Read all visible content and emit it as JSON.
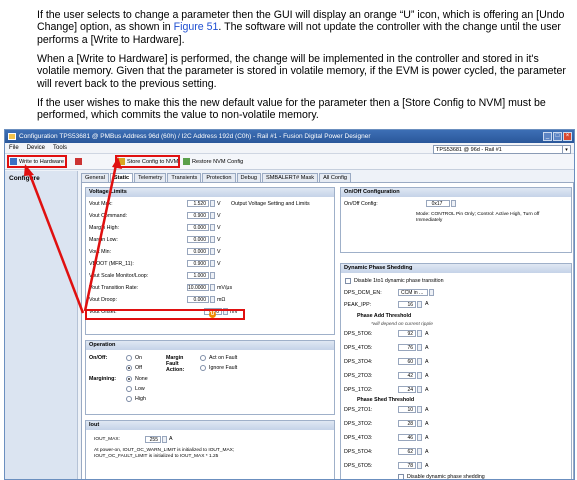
{
  "doc": {
    "p1_a": "If the user selects to change a parameter then the GUI will display an orange “U” icon, which is offering an [Undo Change] option, as shown in ",
    "p1_link": "Figure 51",
    "p1_b": ". The software will not update the controller with the change until the user performs a [Write to Hardware].",
    "p2": "When a [Write to Hardware] is performed, the change will be implemented in the controller and stored in it's volatile memory. Given that the parameter is stored in volatile memory, if the EVM is power cycled, the parameter will revert back to the previous setting.",
    "p3": "If the user wishes to make this the new default value for the parameter then a [Store Config to NVM] must be performed, which commits the value to non-volatile memory."
  },
  "window": {
    "title": "Configuration TPS53681 @ PMBus Address 96d (60h) / I2C Address 192d (C0h) - Rail #1 - Fusion Digital Power Designer",
    "menu": [
      "File",
      "Device",
      "Tools"
    ],
    "device": "TPS53681 @ 96d - Rail #1",
    "toolbar": {
      "write": "Write to Hardware",
      "store": "Store Config to NVM",
      "restore": "Restore NVM Config"
    },
    "nav": "Configure",
    "tabs": [
      "General",
      "Static",
      "Telemetry",
      "Transients",
      "Protection",
      "Debug",
      "SMBALERT# Mask",
      "All Config"
    ]
  },
  "voltage_limits": {
    "title": "Voltage Limits",
    "rows": [
      {
        "label": "Vout Max:",
        "value": "1.520",
        "unit": "V",
        "note": "Output Voltage Setting and Limits"
      },
      {
        "label": "Vout Command:",
        "value": "0.900",
        "unit": "V"
      },
      {
        "label": "Margin High:",
        "value": "0.000",
        "unit": "V"
      },
      {
        "label": "Margin Low:",
        "value": "0.000",
        "unit": "V"
      },
      {
        "label": "Vout Min:",
        "value": "0.000",
        "unit": "V"
      },
      {
        "label": "VBOOT (MFR_11):",
        "value": "0.900",
        "unit": "V"
      },
      {
        "label": "Vout Scale Monitor/Loop:",
        "value": "1.000"
      },
      {
        "label": "Vout Transition Rate:",
        "value": "10.0000",
        "unit": "mV/μs"
      },
      {
        "label": "Vout Droop:",
        "value": "0.000",
        "unit": "mΩ"
      },
      {
        "label": "Vout Offset:",
        "value": "0.00",
        "unit": "mV"
      }
    ],
    "undo_icon": "U"
  },
  "operation": {
    "title": "Operation",
    "onoff_label": "On/Off:",
    "on": "On",
    "off": "Off",
    "margin_label": "Margin Fault Action:",
    "act": "Act on Fault",
    "ignore": "Ignore Fault",
    "margining_label": "Margining:",
    "none": "None",
    "low": "Low",
    "high": "High"
  },
  "iout": {
    "title": "Iout",
    "label": "IOUT_MAX:",
    "value": "255",
    "unit": "A",
    "note1": "At power-on, IOUT_OC_WARN_LIMIT is initialized to IOUT_MAX;",
    "note2": "IOUT_OC_FAULT_LIMIT is initialized to IOUT_MAX * 1.25"
  },
  "onoff_config": {
    "title": "On/Off Configuration",
    "label": "On/Off Config:",
    "value": "0x17",
    "mode": "Mode: CONTROL Pin Only; Control: Active High, Turn off Immediately"
  },
  "dps": {
    "title": "Dynamic Phase Shedding",
    "disable_label": "Disable 1to1 dynamic phase transition",
    "dcm_label": "DPS_DCM_EN:",
    "dcm_value": "CCM in ...",
    "peak_label": "PEAK_IPP:",
    "peak_value": "16",
    "add_title": "Phase Add Threshold",
    "add_note": "*will depend on current ripple",
    "add_rows": [
      {
        "label": "DPS_5TO6:",
        "value": "92"
      },
      {
        "label": "DPS_4TO5:",
        "value": "76"
      },
      {
        "label": "DPS_3TO4:",
        "value": "60"
      },
      {
        "label": "DPS_2TO3:",
        "value": "42"
      },
      {
        "label": "DPS_1TO2:",
        "value": "24"
      }
    ],
    "shed_title": "Phase Shed Threshold",
    "shed_rows": [
      {
        "label": "DPS_2TO1:",
        "value": "10"
      },
      {
        "label": "DPS_3TO2:",
        "value": "28"
      },
      {
        "label": "DPS_4TO3:",
        "value": "46"
      },
      {
        "label": "DPS_5TO4:",
        "value": "62"
      },
      {
        "label": "DPS_6TO5:",
        "value": "78"
      }
    ],
    "unit": "A",
    "disable_shed": "Disable dynamic phase shedding"
  },
  "colors": {
    "accent": "#e01010",
    "link": "#1f4fd1",
    "undo": "#f08a00"
  }
}
